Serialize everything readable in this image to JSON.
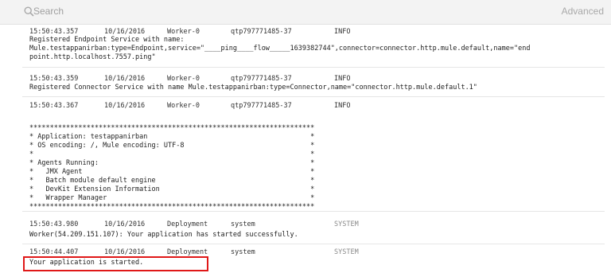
{
  "search": {
    "placeholder": "Search",
    "advanced_label": "Advanced"
  },
  "entries": [
    {
      "time": "15:50:43.357",
      "date": "10/16/2016",
      "thread": "Worker-0",
      "context": "qtp797771485-37",
      "level": "INFO",
      "message": "Registered Endpoint Service with name:\nMule.testappanirban:type=Endpoint,service=\"____ping____flow_____1639382744\",connector=connector.http.mule.default,name=\"end\npoint.http.localhost.7557.ping\""
    },
    {
      "time": "15:50:43.359",
      "date": "10/16/2016",
      "thread": "Worker-0",
      "context": "qtp797771485-37",
      "level": "INFO",
      "message": "Registered Connector Service with name Mule.testappanirban:type=Connector,name=\"connector.http.mule.default.1\""
    },
    {
      "time": "15:50:43.367",
      "date": "10/16/2016",
      "thread": "Worker-0",
      "context": "qtp797771485-37",
      "level": "INFO",
      "message": "**********************************************************************\n* Application: testappanirban                                        *\n* OS encoding: /, Mule encoding: UTF-8                               *\n*                                                                    *\n* Agents Running:                                                    *\n*   JMX Agent                                                        *\n*   Batch module default engine                                      *\n*   DevKit Extension Information                                     *\n*   Wrapper Manager                                                  *\n**********************************************************************"
    },
    {
      "time": "15:50:43.980",
      "date": "10/16/2016",
      "thread": "Deployment",
      "context": "system",
      "level": "SYSTEM",
      "message": "Worker(54.209.151.107): Your application has started successfully."
    },
    {
      "time": "15:50:44.407",
      "date": "10/16/2016",
      "thread": "Deployment",
      "context": "system",
      "level": "SYSTEM",
      "message": "Your application is started."
    }
  ]
}
